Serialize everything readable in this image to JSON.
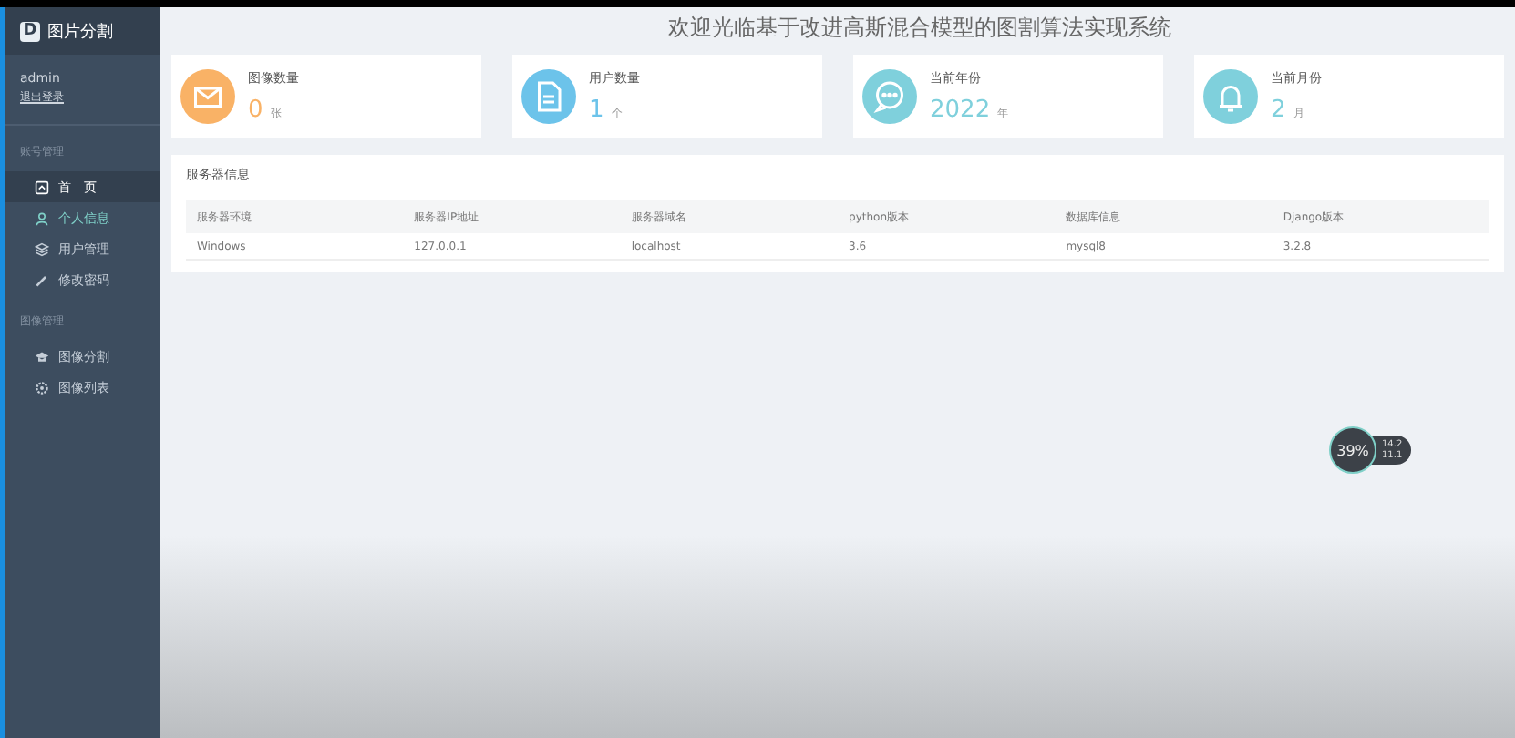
{
  "sidebar": {
    "logo": {
      "letter": "D",
      "title": "图片分割"
    },
    "user": {
      "name": "admin",
      "logout": "退出登录"
    },
    "sections": [
      {
        "title": "账号管理",
        "items": [
          {
            "label": "首　页",
            "kind": "home",
            "selected": true,
            "hovered": false
          },
          {
            "label": "个人信息",
            "kind": "person",
            "selected": false,
            "hovered": true
          },
          {
            "label": "用户管理",
            "kind": "layers",
            "selected": false,
            "hovered": false
          },
          {
            "label": "修改密码",
            "kind": "pen",
            "selected": false,
            "hovered": false
          }
        ]
      },
      {
        "title": "图像管理",
        "items": [
          {
            "label": "图像分割",
            "kind": "cap",
            "selected": false,
            "hovered": false
          },
          {
            "label": "图像列表",
            "kind": "gear",
            "selected": false,
            "hovered": false
          }
        ]
      }
    ]
  },
  "header": {
    "title": "欢迎光临基于改进高斯混合模型的图割算法实现系统"
  },
  "stats": [
    {
      "label": "图像数量",
      "value": "0",
      "unit": "张",
      "kind": "mail",
      "color": "#f9b266"
    },
    {
      "label": "用户数量",
      "value": "1",
      "unit": "个",
      "kind": "doc",
      "color": "#6cc3ea"
    },
    {
      "label": "当前年份",
      "value": "2022",
      "unit": "年",
      "kind": "chat",
      "color": "#7fd0dc"
    },
    {
      "label": "当前月份",
      "value": "2",
      "unit": "月",
      "kind": "bell",
      "color": "#7fd0dc"
    }
  ],
  "server": {
    "title": "服务器信息",
    "columns": [
      "服务器环境",
      "服务器IP地址",
      "服务器域名",
      "python版本",
      "数据库信息",
      "Django版本"
    ],
    "rows": [
      [
        "Windows",
        "127.0.0.1",
        "localhost",
        "3.6",
        "mysql8",
        "3.2.8"
      ]
    ]
  },
  "speed_widget": {
    "percent": "39%",
    "upload": "14.2",
    "download": "11.1"
  }
}
